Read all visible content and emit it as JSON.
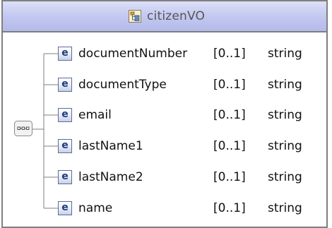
{
  "type_name": "citizenVO",
  "elements": [
    {
      "name": "documentNumber",
      "cardinality": "[0..1]",
      "type": "string",
      "icon": "e"
    },
    {
      "name": "documentType",
      "cardinality": "[0..1]",
      "type": "string",
      "icon": "e"
    },
    {
      "name": "email",
      "cardinality": "[0..1]",
      "type": "string",
      "icon": "e"
    },
    {
      "name": "lastName1",
      "cardinality": "[0..1]",
      "type": "string",
      "icon": "e"
    },
    {
      "name": "lastName2",
      "cardinality": "[0..1]",
      "type": "string",
      "icon": "e"
    },
    {
      "name": "name",
      "cardinality": "[0..1]",
      "type": "string",
      "icon": "e"
    }
  ],
  "colors": {
    "header_gradient_top": "#dde0f8",
    "header_gradient_bottom": "#b4baea",
    "border": "#7f7f7f",
    "icon_text": "#1a3a8a",
    "tree_line": "#7f7f7f"
  },
  "icons": {
    "header": "complex-type-icon",
    "sequence": "sequence-compositor-icon",
    "element": "element-icon"
  }
}
